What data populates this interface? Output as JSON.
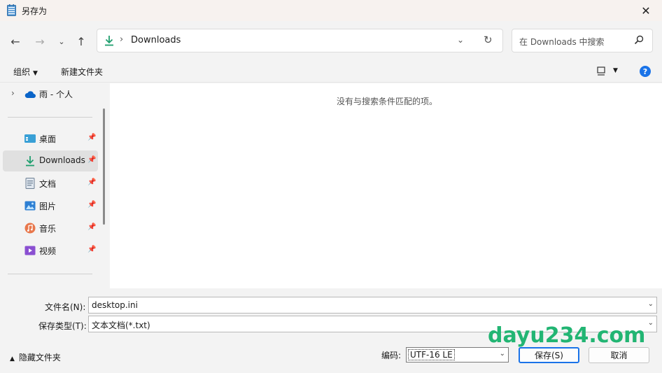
{
  "window": {
    "title": "另存为"
  },
  "nav": {
    "address_path": "Downloads",
    "address_separator": "›",
    "search_placeholder": "在 Downloads 中搜索"
  },
  "toolbar": {
    "organize": "组织",
    "new_folder": "新建文件夹",
    "help": "?"
  },
  "sidebar": {
    "onedrive": "雨 - 个人",
    "items": [
      {
        "label": "桌面",
        "icon": "desktop-icon"
      },
      {
        "label": "Downloads",
        "icon": "download-icon",
        "selected": true
      },
      {
        "label": "文档",
        "icon": "document-icon"
      },
      {
        "label": "图片",
        "icon": "picture-icon"
      },
      {
        "label": "音乐",
        "icon": "music-icon"
      },
      {
        "label": "视频",
        "icon": "video-icon"
      }
    ]
  },
  "content": {
    "empty_message": "没有与搜索条件匹配的项。"
  },
  "form": {
    "filename_label": "文件名(N):",
    "filename_value": "desktop.ini",
    "filetype_label": "保存类型(T):",
    "filetype_value": "文本文档(*.txt)"
  },
  "footer": {
    "hide_folders": "隐藏文件夹",
    "encoding_label": "编码:",
    "encoding_value": "UTF-16 LE",
    "save_button": "保存(S)",
    "cancel_button": "取消"
  },
  "watermark": "dayu234.com",
  "colors": {
    "accent": "#1a73e8",
    "watermark": "#22b573",
    "download_green": "#1f9e6e"
  }
}
